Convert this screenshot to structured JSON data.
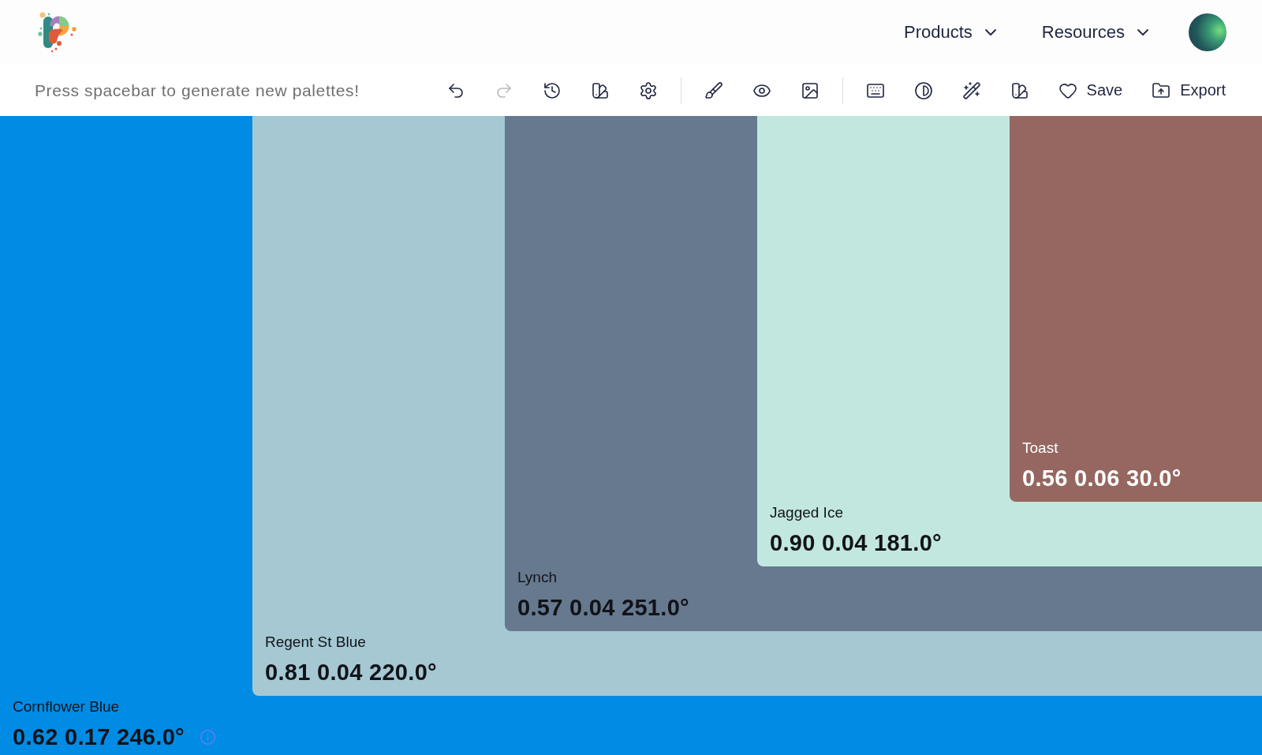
{
  "header": {
    "nav": [
      {
        "label": "Products"
      },
      {
        "label": "Resources"
      }
    ]
  },
  "toolbar": {
    "hint": "Press spacebar to generate new palettes!",
    "undo": {
      "disabled": false
    },
    "redo": {
      "disabled": true
    },
    "buttons": [
      {
        "label": "Save"
      },
      {
        "label": "Export"
      }
    ]
  },
  "palette": [
    {
      "name": "Cornflower Blue",
      "value": "0.62 0.17 246.0°",
      "color": "#008ce5",
      "light_label": false,
      "info_icon": true
    },
    {
      "name": "Regent St Blue",
      "value": "0.81 0.04 220.0°",
      "color": "#a5c8d3",
      "light_label": false,
      "info_icon": false
    },
    {
      "name": "Lynch",
      "value": "0.57 0.04 251.0°",
      "color": "#66798f",
      "light_label": false,
      "info_icon": false
    },
    {
      "name": "Jagged Ice",
      "value": "0.90 0.04 181.0°",
      "color": "#c2e7df",
      "light_label": false,
      "info_icon": false
    },
    {
      "name": "Toast",
      "value": "0.56 0.06 30.0°",
      "color": "#956760",
      "light_label": true,
      "info_icon": false
    }
  ]
}
